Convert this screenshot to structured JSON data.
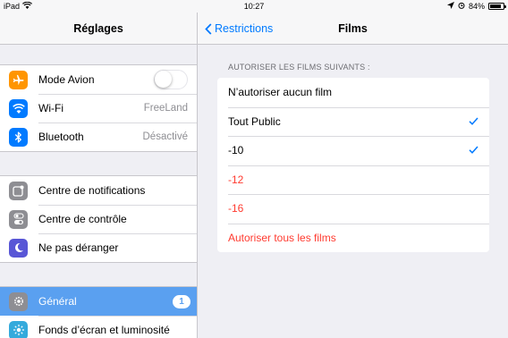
{
  "status_bar": {
    "device": "iPad",
    "time": "10:27",
    "battery": "84%",
    "battery_level": 0.84
  },
  "master": {
    "title": "Réglages",
    "groups": [
      {
        "items": [
          {
            "label": "Mode Avion",
            "icon": "airplane-icon",
            "color": "#ff9500",
            "toggle": false
          },
          {
            "label": "Wi-Fi",
            "value": "FreeLand",
            "icon": "wifi-icon",
            "color": "#007aff"
          },
          {
            "label": "Bluetooth",
            "value": "Désactivé",
            "icon": "bluetooth-icon",
            "color": "#007aff"
          }
        ]
      },
      {
        "items": [
          {
            "label": "Centre de notifications",
            "icon": "notifications-icon",
            "color": "#8e8e93"
          },
          {
            "label": "Centre de contrôle",
            "icon": "control-center-icon",
            "color": "#8e8e93"
          },
          {
            "label": "Ne pas déranger",
            "icon": "moon-icon",
            "color": "#5856d6"
          }
        ]
      },
      {
        "items": [
          {
            "label": "Général",
            "icon": "gear-icon",
            "color": "#8e8e93",
            "badge": "1",
            "selected": true
          },
          {
            "label": "Fonds d’écran et luminosité",
            "icon": "wallpaper-icon",
            "color": "#34aadc"
          }
        ]
      }
    ]
  },
  "detail": {
    "back_label": "Restrictions",
    "title": "Films",
    "section_header": "AUTORISER LES FILMS SUIVANTS :",
    "options": [
      {
        "label": "N’autoriser aucun film",
        "checked": false,
        "restricted": false
      },
      {
        "label": "Tout Public",
        "checked": true,
        "restricted": false
      },
      {
        "label": "-10",
        "checked": true,
        "restricted": false
      },
      {
        "label": "-12",
        "checked": false,
        "restricted": true
      },
      {
        "label": "-16",
        "checked": false,
        "restricted": true
      },
      {
        "label": "Autoriser tous les films",
        "checked": false,
        "restricted": true
      }
    ]
  },
  "colors": {
    "accent": "#007aff",
    "selected_row": "#5aa0f0",
    "restricted_text": "#ff3b30"
  }
}
